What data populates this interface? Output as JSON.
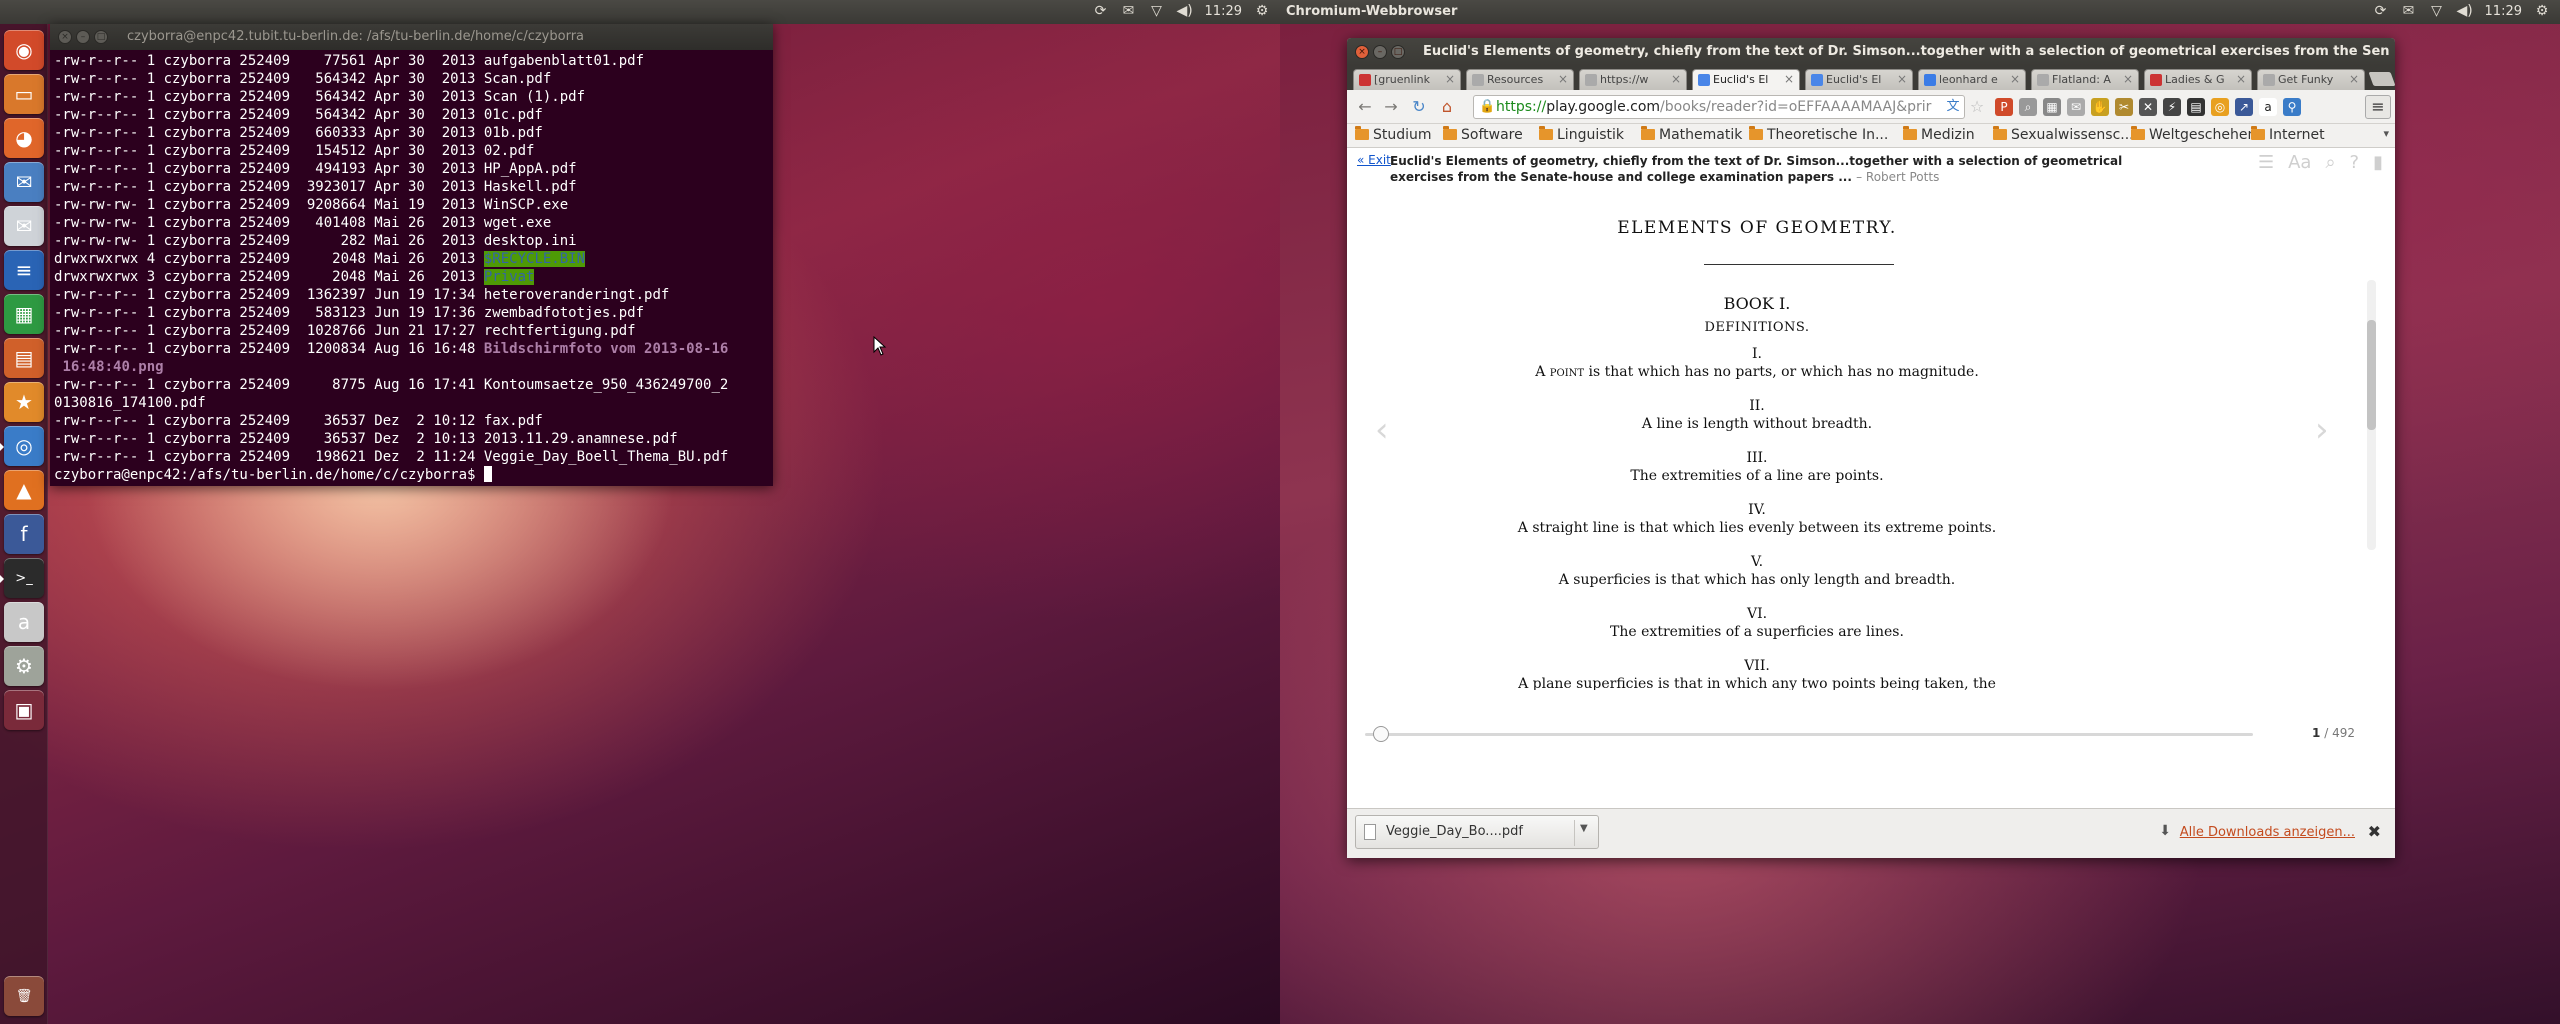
{
  "top_panel_left": {
    "title": "",
    "clock": "11:29"
  },
  "top_panel_right": {
    "title": "Chromium-Webbrowser",
    "clock": "11:29"
  },
  "terminal": {
    "title": "czyborra@enpc42.tubit.tu-berlin.de: /afs/tu-berlin.de/home/c/czyborra",
    "lines": [
      {
        "text": "-rw-r--r-- 1 czyborra 252409    77561 Apr 30  2013 aufgabenblatt01.pdf"
      },
      {
        "text": "-rw-r--r-- 1 czyborra 252409   564342 Apr 30  2013 Scan.pdf"
      },
      {
        "text": "-rw-r--r-- 1 czyborra 252409   564342 Apr 30  2013 Scan (1).pdf"
      },
      {
        "text": "-rw-r--r-- 1 czyborra 252409   564342 Apr 30  2013 01c.pdf"
      },
      {
        "text": "-rw-r--r-- 1 czyborra 252409   660333 Apr 30  2013 01b.pdf"
      },
      {
        "text": "-rw-r--r-- 1 czyborra 252409   154512 Apr 30  2013 02.pdf"
      },
      {
        "text": "-rw-r--r-- 1 czyborra 252409   494193 Apr 30  2013 HP_AppA.pdf"
      },
      {
        "text": "-rw-r--r-- 1 czyborra 252409  3923017 Apr 30  2013 Haskell.pdf"
      },
      {
        "text": "-rw-rw-rw- 1 czyborra 252409  9208664 Mai 19  2013 WinSCP.exe"
      },
      {
        "text": "-rw-rw-rw- 1 czyborra 252409   401408 Mai 26  2013 wget.exe"
      },
      {
        "text": "-rw-rw-rw- 1 czyborra 252409      282 Mai 26  2013 desktop.ini"
      },
      {
        "text": "drwxrwxrwx 4 czyborra 252409     2048 Mai 26  2013 ",
        "hl": "$RECYCLE.BIN"
      },
      {
        "text": "drwxrwxrwx 3 czyborra 252409     2048 Mai 26  2013 ",
        "hl": "Privat"
      },
      {
        "text": "-rw-r--r-- 1 czyborra 252409  1362397 Jun 19 17:34 heteroveranderingt.pdf"
      },
      {
        "text": "-rw-r--r-- 1 czyborra 252409   583123 Jun 19 17:36 zwembadfototjes.pdf"
      },
      {
        "text": "-rw-r--r-- 1 czyborra 252409  1028766 Jun 21 17:27 rechtfertigung.pdf"
      },
      {
        "text": "-rw-r--r-- 1 czyborra 252409  1200834 Aug 16 16:48 ",
        "png": "Bildschirmfoto vom 2013-08-16"
      },
      {
        "text": " ",
        "png": "16:48:40.png"
      },
      {
        "text": "-rw-r--r-- 1 czyborra 252409     8775 Aug 16 17:41 Kontoumsaetze_950_436249700_2"
      },
      {
        "text": "0130816_174100.pdf"
      },
      {
        "text": "-rw-r--r-- 1 czyborra 252409    36537 Dez  2 10:12 fax.pdf"
      },
      {
        "text": "-rw-r--r-- 1 czyborra 252409    36537 Dez  2 10:13 2013.11.29.anamnese.pdf"
      },
      {
        "text": "-rw-r--r-- 1 czyborra 252409   198621 Dez  2 11:24 Veggie_Day_Boell_Thema_BU.pdf"
      },
      {
        "text": "czyborra@enpc42:/afs/tu-berlin.de/home/c/czyborra$ ",
        "cursor": true
      }
    ]
  },
  "launcher": {
    "items": [
      {
        "name": "dash-home-icon",
        "color": "#d24a2a",
        "glyph": "◉"
      },
      {
        "name": "files-icon",
        "color": "#d9782b",
        "glyph": "▭"
      },
      {
        "name": "firefox-icon",
        "color": "#e0662a",
        "glyph": "◕"
      },
      {
        "name": "thunderbird-icon",
        "color": "#4a7fc1",
        "glyph": "✉"
      },
      {
        "name": "mail-icon",
        "color": "#cfd3d8",
        "glyph": "✉"
      },
      {
        "name": "writer-icon",
        "color": "#2a64b5",
        "glyph": "≡"
      },
      {
        "name": "calc-icon",
        "color": "#2e9a42",
        "glyph": "▦"
      },
      {
        "name": "impress-icon",
        "color": "#d0602a",
        "glyph": "▤"
      },
      {
        "name": "software-center-icon",
        "color": "#e18a2a",
        "glyph": "★"
      },
      {
        "name": "chromium-icon",
        "color": "#3a7cc8",
        "glyph": "◎"
      },
      {
        "name": "matlab-icon",
        "color": "#e07020",
        "glyph": "▲"
      },
      {
        "name": "facebook-icon",
        "color": "#3b5998",
        "glyph": "f"
      },
      {
        "name": "terminal-icon",
        "color": "#2b2b2b",
        "glyph": ">_"
      },
      {
        "name": "amazon-icon",
        "color": "#c8c8c8",
        "glyph": "a"
      },
      {
        "name": "settings-icon",
        "color": "#9ea39a",
        "glyph": "⚙"
      },
      {
        "name": "workspace-icon",
        "color": "#7a2a3a",
        "glyph": "▣"
      },
      {
        "name": "trash-icon",
        "color": "#8a4a3a",
        "glyph": "🗑"
      }
    ]
  },
  "browser": {
    "title": "Euclid's Elements of geometry, chiefly from the text of Dr. Simson...together with a selection of geometrical exercises from the Sen",
    "tabs": [
      {
        "label": "[gruenlink",
        "color": "#c33"
      },
      {
        "label": "Resources",
        "color": "#aaa"
      },
      {
        "label": "https://w",
        "color": "#aaa"
      },
      {
        "label": "Euclid's El",
        "color": "#4a86e8",
        "active": true
      },
      {
        "label": "Euclid's El",
        "color": "#4a86e8"
      },
      {
        "label": "leonhard e",
        "color": "#3b7ce6"
      },
      {
        "label": "Flatland: A",
        "color": "#aaa"
      },
      {
        "label": "Ladies & G",
        "color": "#c33"
      },
      {
        "label": "Get Funky",
        "color": "#aaa"
      }
    ],
    "url": {
      "scheme": "https://",
      "host": "play.google.com",
      "path": "/books/reader?id=oEFFAAAAMAAJ&prir"
    },
    "bookmarks": [
      "Studium",
      "Software",
      "Linguistik",
      "Mathematik",
      "Theoretische In...",
      "Medizin",
      "Sexualwissensc...",
      "Weltgeschehen",
      "Internet"
    ],
    "reader": {
      "exit": "« Exit",
      "book_title": "Euclid's Elements of geometry, chiefly from the text of Dr. Simson...together with a selection of geometrical exercises from the Senate-house and college examination papers ...",
      "author": "– Robert Potts",
      "page": {
        "heading": "ELEMENTS OF GEOMETRY.",
        "book": "BOOK I.",
        "definitions": "DEFINITIONS.",
        "defs": [
          {
            "num": "I.",
            "lead": "A point",
            "text": " is that which has no parts, or which has no magnitude."
          },
          {
            "num": "II.",
            "lead": "",
            "text": "A line is length without breadth."
          },
          {
            "num": "III.",
            "lead": "",
            "text": "The extremities of a line are points."
          },
          {
            "num": "IV.",
            "lead": "",
            "text": "A straight line is that which lies evenly between its extreme points."
          },
          {
            "num": "V.",
            "lead": "",
            "text": "A superficies is that which has only length and breadth."
          },
          {
            "num": "VI.",
            "lead": "",
            "text": "The extremities of a superficies are lines."
          },
          {
            "num": "VII.",
            "lead": "",
            "text": "A plane superficies is that in which any two points being taken, the"
          }
        ]
      },
      "current_page": "1",
      "total_pages": "/ 492",
      "progress": 0.0
    },
    "download": {
      "file": "Veggie_Day_Bo....pdf",
      "show_all": "Alle Downloads anzeigen..."
    }
  }
}
